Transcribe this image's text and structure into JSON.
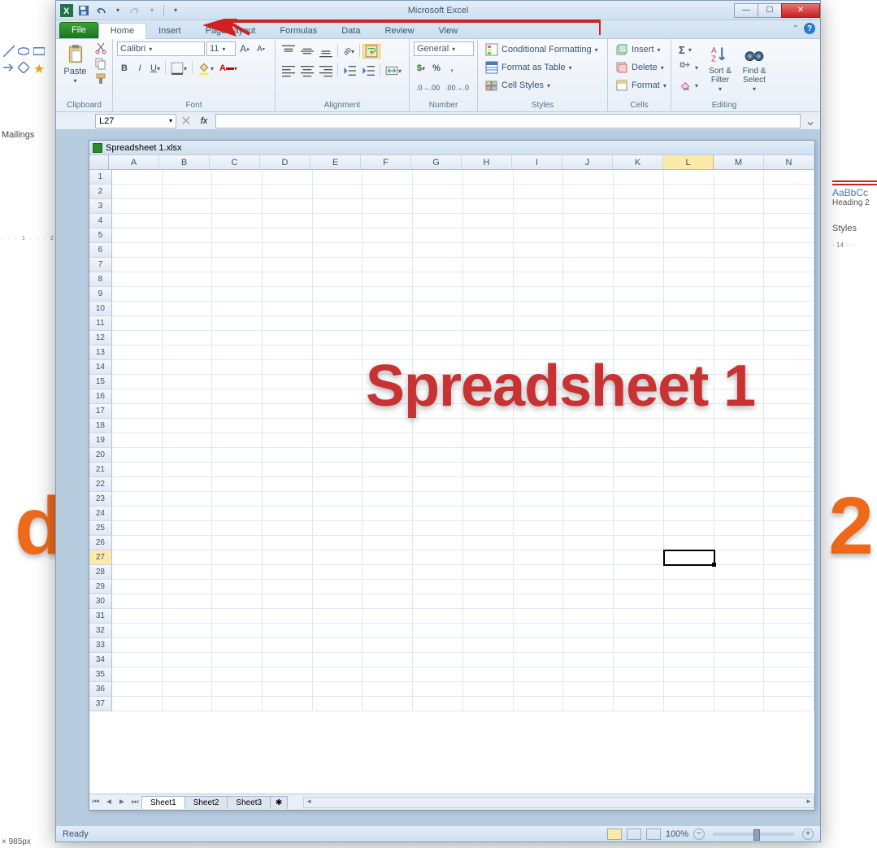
{
  "bg": {
    "mailings": "Mailings",
    "heading2": "AaBbCc",
    "heading2_label": "Heading 2",
    "styles": "Styles",
    "d": "d",
    "two": "2",
    "status": "× 985px"
  },
  "app_title": "Microsoft Excel",
  "tabs": {
    "file": "File",
    "home": "Home",
    "insert": "Insert",
    "page": "Page Layout",
    "formulas": "Formulas",
    "data": "Data",
    "review": "Review",
    "view": "View"
  },
  "ribbon": {
    "clipboard": {
      "paste": "Paste",
      "label": "Clipboard"
    },
    "font": {
      "name": "Calibri",
      "size": "11",
      "label": "Font"
    },
    "alignment": {
      "label": "Alignment"
    },
    "number": {
      "format": "General",
      "label": "Number"
    },
    "styles": {
      "cond": "Conditional Formatting",
      "table": "Format as Table",
      "cell": "Cell Styles",
      "label": "Styles"
    },
    "cells": {
      "insert": "Insert",
      "delete": "Delete",
      "format": "Format",
      "label": "Cells"
    },
    "editing": {
      "sort": "Sort & Filter",
      "find": "Find & Select",
      "label": "Editing"
    }
  },
  "name_box": "L27",
  "fx": "fx",
  "workbook_title": "Spreadsheet 1.xlsx",
  "columns": [
    "A",
    "B",
    "C",
    "D",
    "E",
    "F",
    "G",
    "H",
    "I",
    "J",
    "K",
    "L",
    "M",
    "N"
  ],
  "rows": [
    1,
    2,
    3,
    4,
    5,
    6,
    7,
    8,
    9,
    10,
    11,
    12,
    13,
    14,
    15,
    16,
    17,
    18,
    19,
    20,
    21,
    22,
    23,
    24,
    25,
    26,
    27,
    28,
    29,
    30,
    31,
    32,
    33,
    34,
    35,
    36,
    37
  ],
  "active_cell": {
    "row": 27,
    "col": "L"
  },
  "overlay": "Spreadsheet 1",
  "sheets": {
    "s1": "Sheet1",
    "s2": "Sheet2",
    "s3": "Sheet3"
  },
  "status": {
    "ready": "Ready",
    "zoom": "100%"
  }
}
